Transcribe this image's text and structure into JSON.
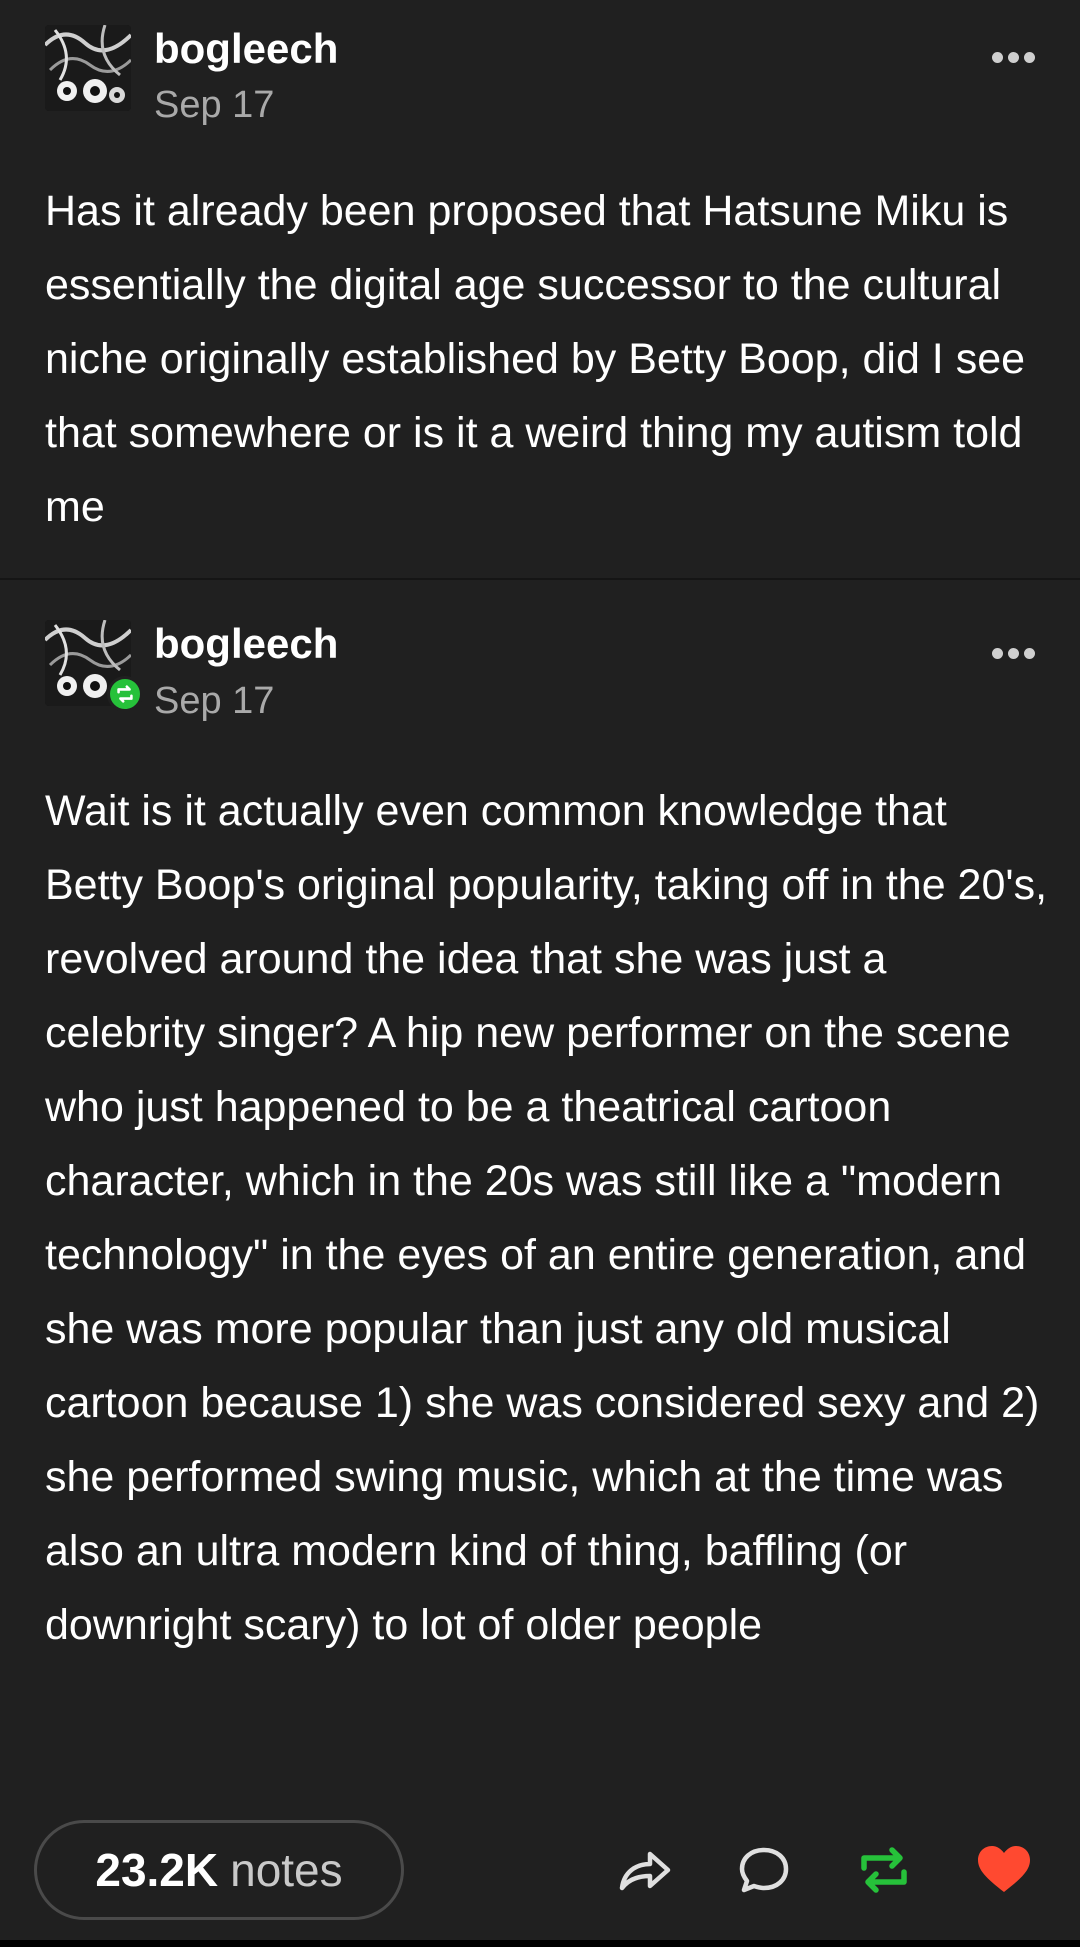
{
  "posts": [
    {
      "username": "bogleech",
      "date": "Sep 17",
      "body": "Has it already been proposed that Hatsune Miku is essentially the digital age successor to the cultural niche originally established by Betty Boop, did I see that somewhere or is it a weird thing my autism told me"
    },
    {
      "username": "bogleech",
      "date": "Sep 17",
      "body": "Wait is it actually even common knowledge that Betty Boop's original popularity, taking off in the 20's, revolved around the idea that she was just a celebrity singer? A hip new performer on the scene who just happened to be a theatrical cartoon character, which in the 20s was still like a \"modern technology\" in the eyes of an entire generation, and she was more popular than just any old musical cartoon because 1) she was considered sexy and 2) she performed swing music, which at the time was also an ultra modern kind of thing, baffling (or downright scary) to lot of older people"
    }
  ],
  "footer": {
    "notes_count": "23.2K",
    "notes_label": "notes"
  },
  "colors": {
    "background": "#202020",
    "reblog_green": "#26c13a",
    "like_red": "#ff4930",
    "muted_text": "#a9a9a9"
  },
  "icons": [
    "more-options-icon",
    "reblog-badge-icon",
    "share-icon",
    "reply-icon",
    "reblog-icon",
    "like-heart-icon"
  ]
}
